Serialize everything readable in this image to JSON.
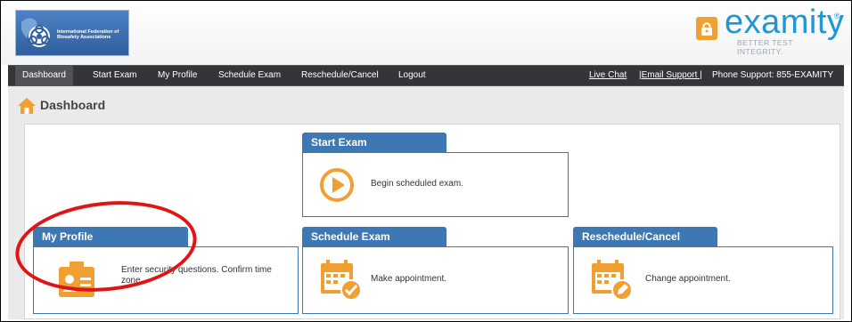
{
  "header": {
    "org_name": "International Federation of Biosafety Associations",
    "brand_name": "examity",
    "brand_reg": "®",
    "brand_tagline": "BETTER TEST INTEGRITY."
  },
  "nav": {
    "items": [
      "Dashboard",
      "Start Exam",
      "My Profile",
      "Schedule Exam",
      "Reschedule/Cancel",
      "Logout"
    ],
    "active": "Dashboard",
    "live_chat": "Live Chat",
    "email_support": "|Email Support |",
    "phone_support": "Phone Support: 855-EXAMITY"
  },
  "page": {
    "title": "Dashboard"
  },
  "cards": {
    "start_exam": {
      "title": "Start Exam",
      "desc": "Begin scheduled exam."
    },
    "my_profile": {
      "title": "My Profile",
      "desc": "Enter security questions. Confirm time zone."
    },
    "schedule_exam": {
      "title": "Schedule Exam",
      "desc": "Make appointment."
    },
    "reschedule": {
      "title": "Reschedule/Cancel",
      "desc": "Change appointment."
    }
  },
  "colors": {
    "accent": "#3d78b5",
    "icon_orange": "#f0a032",
    "brand_blue": "#1f97d4",
    "highlight_red": "#e01414"
  }
}
